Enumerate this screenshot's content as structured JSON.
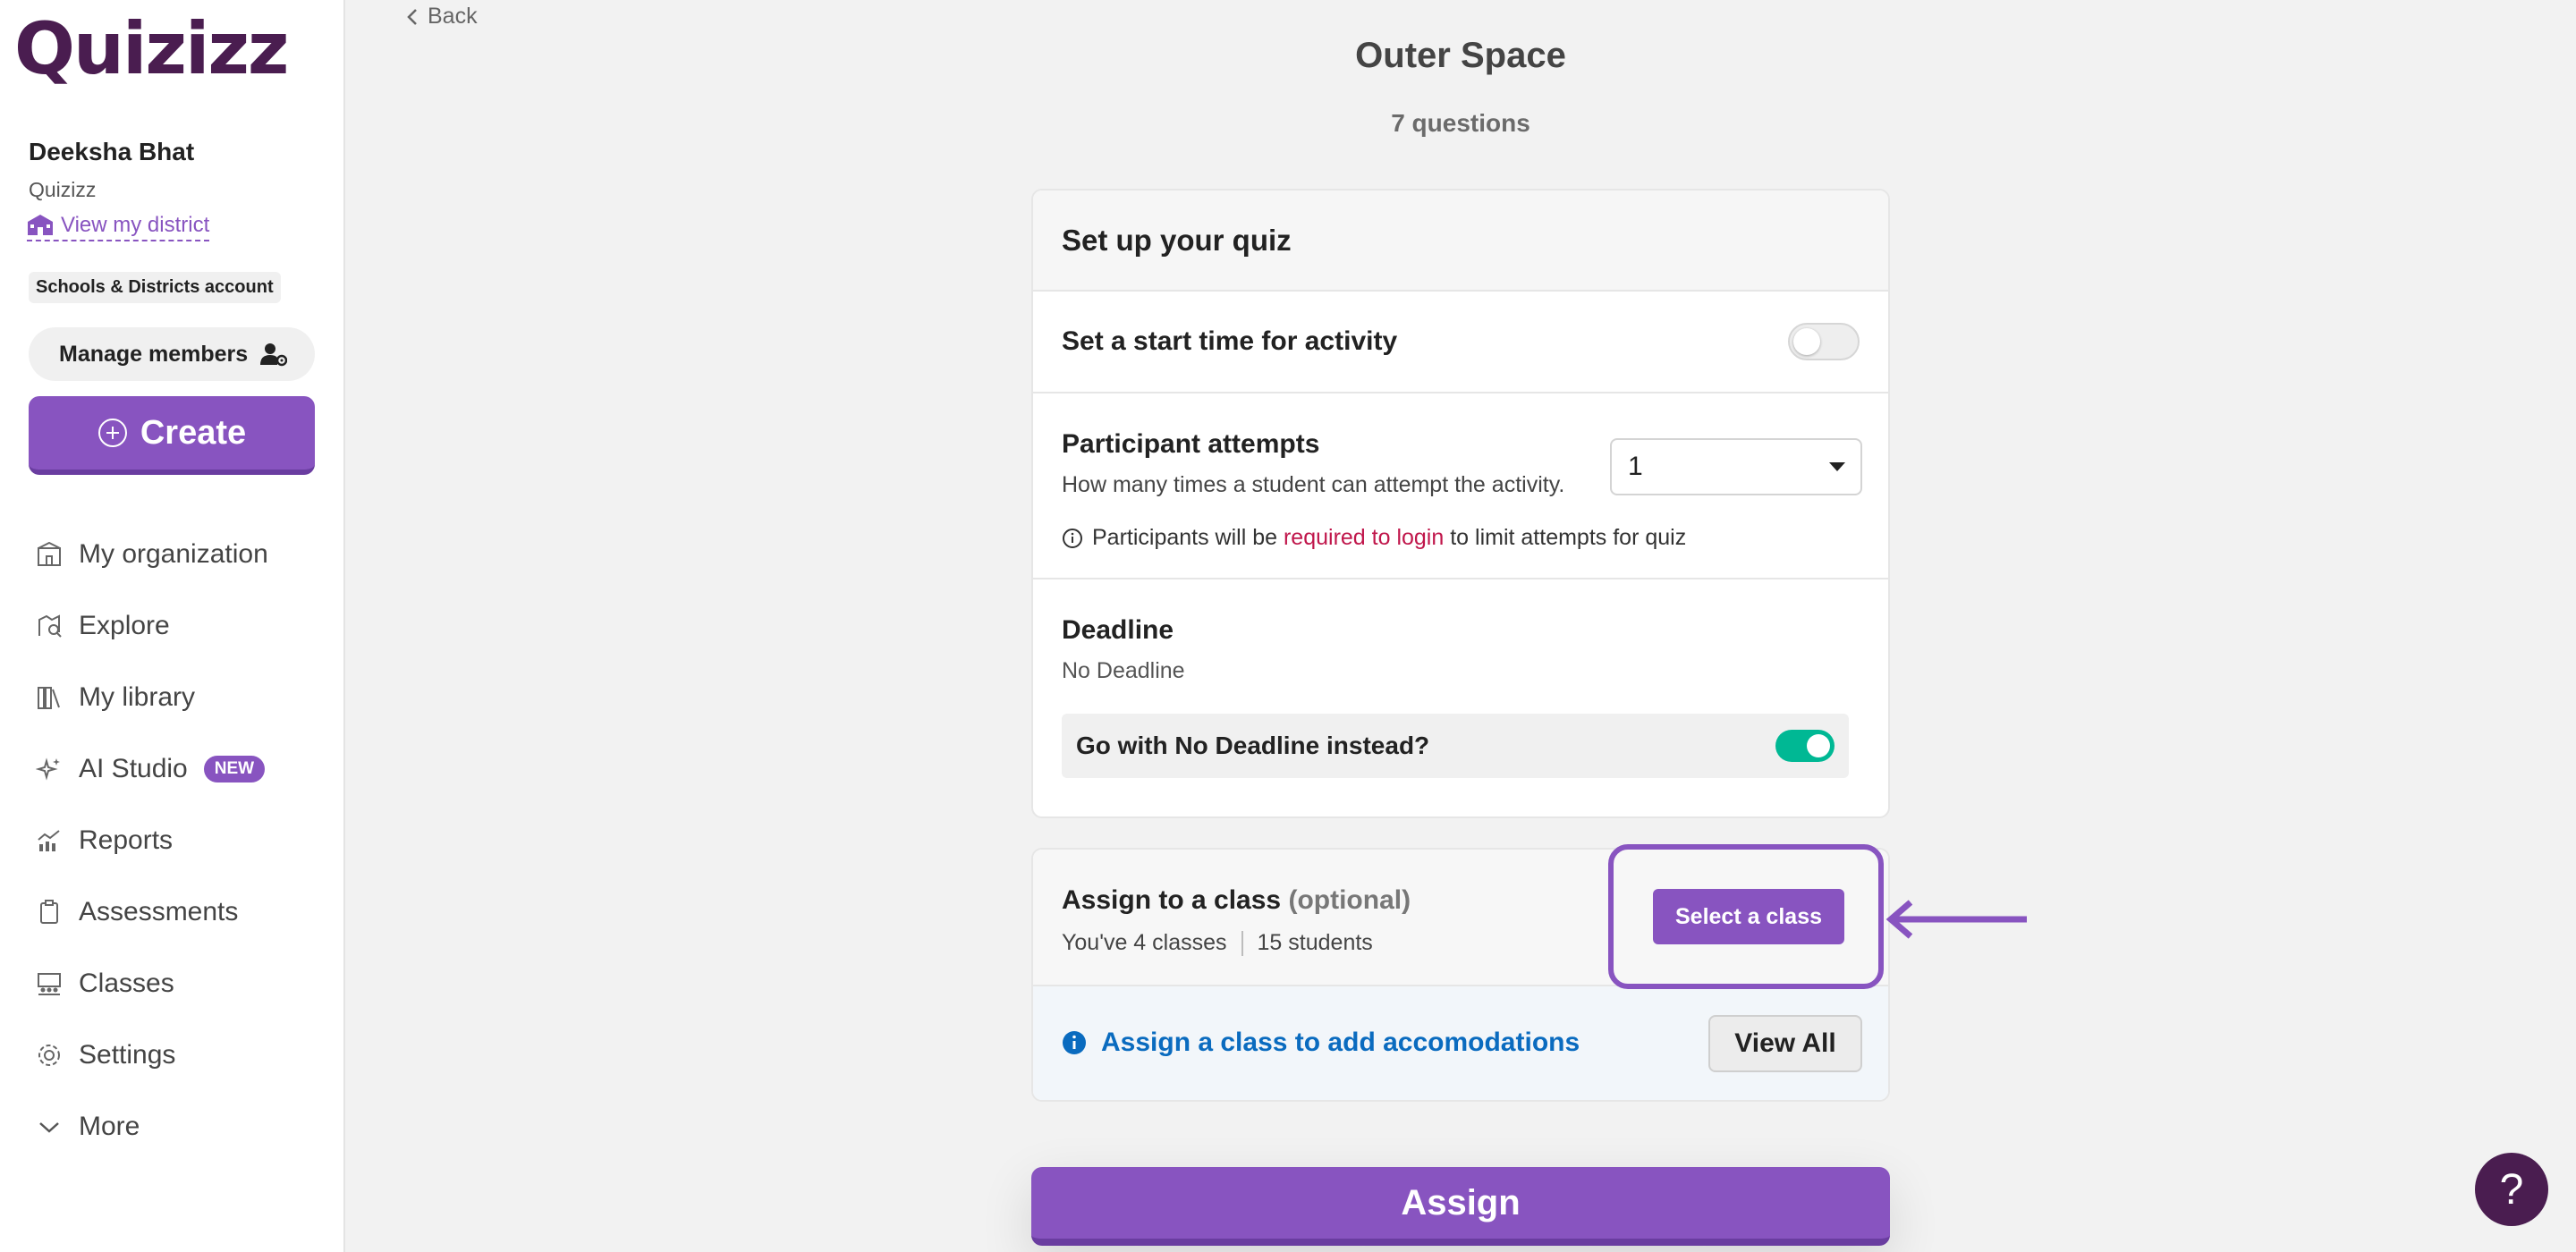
{
  "brand": {
    "logo_text": "Quizizz",
    "accent": "#8854c0",
    "logo_color": "#4a1d50"
  },
  "user": {
    "name": "Deeksha Bhat",
    "org": "Quizizz",
    "district_link": "View my district",
    "account_badge": "Schools & Districts account"
  },
  "sidebar": {
    "manage_members": "Manage members",
    "create": "Create",
    "items": [
      {
        "label": "My organization",
        "icon": "building-icon"
      },
      {
        "label": "Explore",
        "icon": "compass-icon"
      },
      {
        "label": "My library",
        "icon": "library-icon"
      },
      {
        "label": "AI Studio",
        "icon": "sparkle-icon",
        "badge": "NEW"
      },
      {
        "label": "Reports",
        "icon": "chart-icon"
      },
      {
        "label": "Assessments",
        "icon": "clipboard-icon"
      },
      {
        "label": "Classes",
        "icon": "classes-icon"
      },
      {
        "label": "Settings",
        "icon": "gear-icon"
      },
      {
        "label": "More",
        "icon": "chevron-down-icon"
      }
    ]
  },
  "main": {
    "back": "Back",
    "title": "Outer Space",
    "subtitle": "7 questions",
    "setup": {
      "header": "Set up your quiz",
      "start_time_label": "Set a start time for activity",
      "start_time_on": false,
      "attempts_title": "Participant attempts",
      "attempts_desc": "How many times a student can attempt the activity.",
      "attempts_value": "1",
      "attempts_note_pre": "Participants will be ",
      "attempts_note_link": "required to login",
      "attempts_note_post": " to limit attempts for quiz",
      "deadline_title": "Deadline",
      "deadline_value": "No Deadline",
      "no_deadline_prompt": "Go with No Deadline instead?",
      "no_deadline_on": true
    },
    "assign_class": {
      "title": "Assign to a class",
      "optional": "(optional)",
      "classes_count": "You've 4 classes",
      "students_count": "15 students",
      "select_button": "Select a class",
      "accommodations_link": "Assign a class to add accomodations",
      "view_all": "View All"
    },
    "assign_button": "Assign",
    "help": "?"
  }
}
